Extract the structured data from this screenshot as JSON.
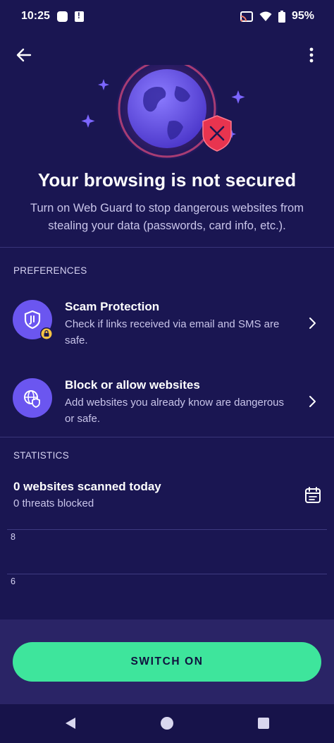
{
  "status_bar": {
    "time": "10:25",
    "battery": "95%"
  },
  "hero": {
    "title": "Your browsing is not secured",
    "subtitle": "Turn on Web Guard to stop dangerous websites from stealing your data (passwords, card info, etc.)."
  },
  "preferences": {
    "label": "PREFERENCES",
    "items": [
      {
        "title": "Scam Protection",
        "description": "Check if links received via email and SMS are safe.",
        "icon": "scam-shield-icon"
      },
      {
        "title": "Block or allow websites",
        "description": "Add websites you already know are dangerous or safe.",
        "icon": "globe-shield-icon"
      }
    ]
  },
  "statistics": {
    "label": "STATISTICS",
    "scanned": "0 websites scanned today",
    "blocked": "0 threats blocked",
    "chart_ticks": [
      "8",
      "6"
    ]
  },
  "action": {
    "button_label": "SWITCH ON"
  },
  "colors": {
    "background": "#1a1652",
    "accent_green": "#3ee59c",
    "accent_purple": "#6b56f0",
    "danger_red": "#e8344f"
  }
}
